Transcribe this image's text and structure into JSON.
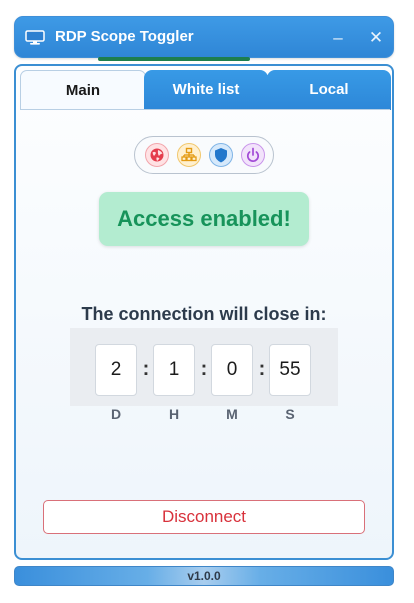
{
  "window": {
    "title": "RDP Scope Toggler",
    "minimize_glyph": "–",
    "close_glyph": "✕"
  },
  "tabs": [
    {
      "label": "Main",
      "active": true
    },
    {
      "label": "White list",
      "active": false
    },
    {
      "label": "Local",
      "active": false
    }
  ],
  "icons": [
    "globe-icon",
    "network-icon",
    "shield-icon",
    "power-icon"
  ],
  "status": {
    "text": "Access enabled!",
    "color": "#17935a"
  },
  "countdown": {
    "label": "The connection will close in:",
    "days": "2",
    "hours": "1",
    "minutes": "0",
    "seconds": "55",
    "separator": ":",
    "units": {
      "days": "D",
      "hours": "H",
      "minutes": "M",
      "seconds": "S"
    }
  },
  "disconnect_label": "Disconnect",
  "footer": {
    "version": "v1.0.0"
  },
  "colors": {
    "accent": "#2f86d6",
    "danger": "#d8313b",
    "success_bg": "#b3ecd0"
  }
}
